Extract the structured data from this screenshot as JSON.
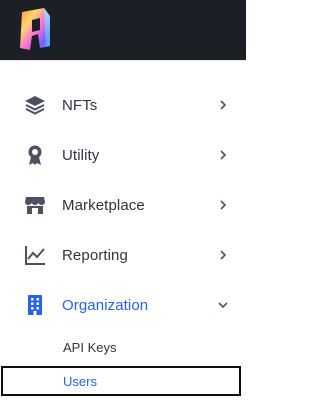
{
  "header": {
    "logo_icon": "brand-logo-icon"
  },
  "nav": {
    "items": [
      {
        "label": "NFTs",
        "icon": "layers-icon",
        "chevron": "chevron-right-icon"
      },
      {
        "label": "Utility",
        "icon": "badge-icon",
        "chevron": "chevron-right-icon"
      },
      {
        "label": "Marketplace",
        "icon": "storefront-icon",
        "chevron": "chevron-right-icon"
      },
      {
        "label": "Reporting",
        "icon": "line-chart-icon",
        "chevron": "chevron-right-icon"
      },
      {
        "label": "Organization",
        "icon": "building-icon",
        "chevron": "chevron-down-icon",
        "active": true
      }
    ],
    "sub_items": [
      {
        "label": "API Keys"
      },
      {
        "label": "Users",
        "selected": true
      }
    ]
  },
  "colors": {
    "header_bg": "#1d1f27",
    "text": "#2f3440",
    "accent": "#2563eb",
    "icon": "#4b5160"
  }
}
